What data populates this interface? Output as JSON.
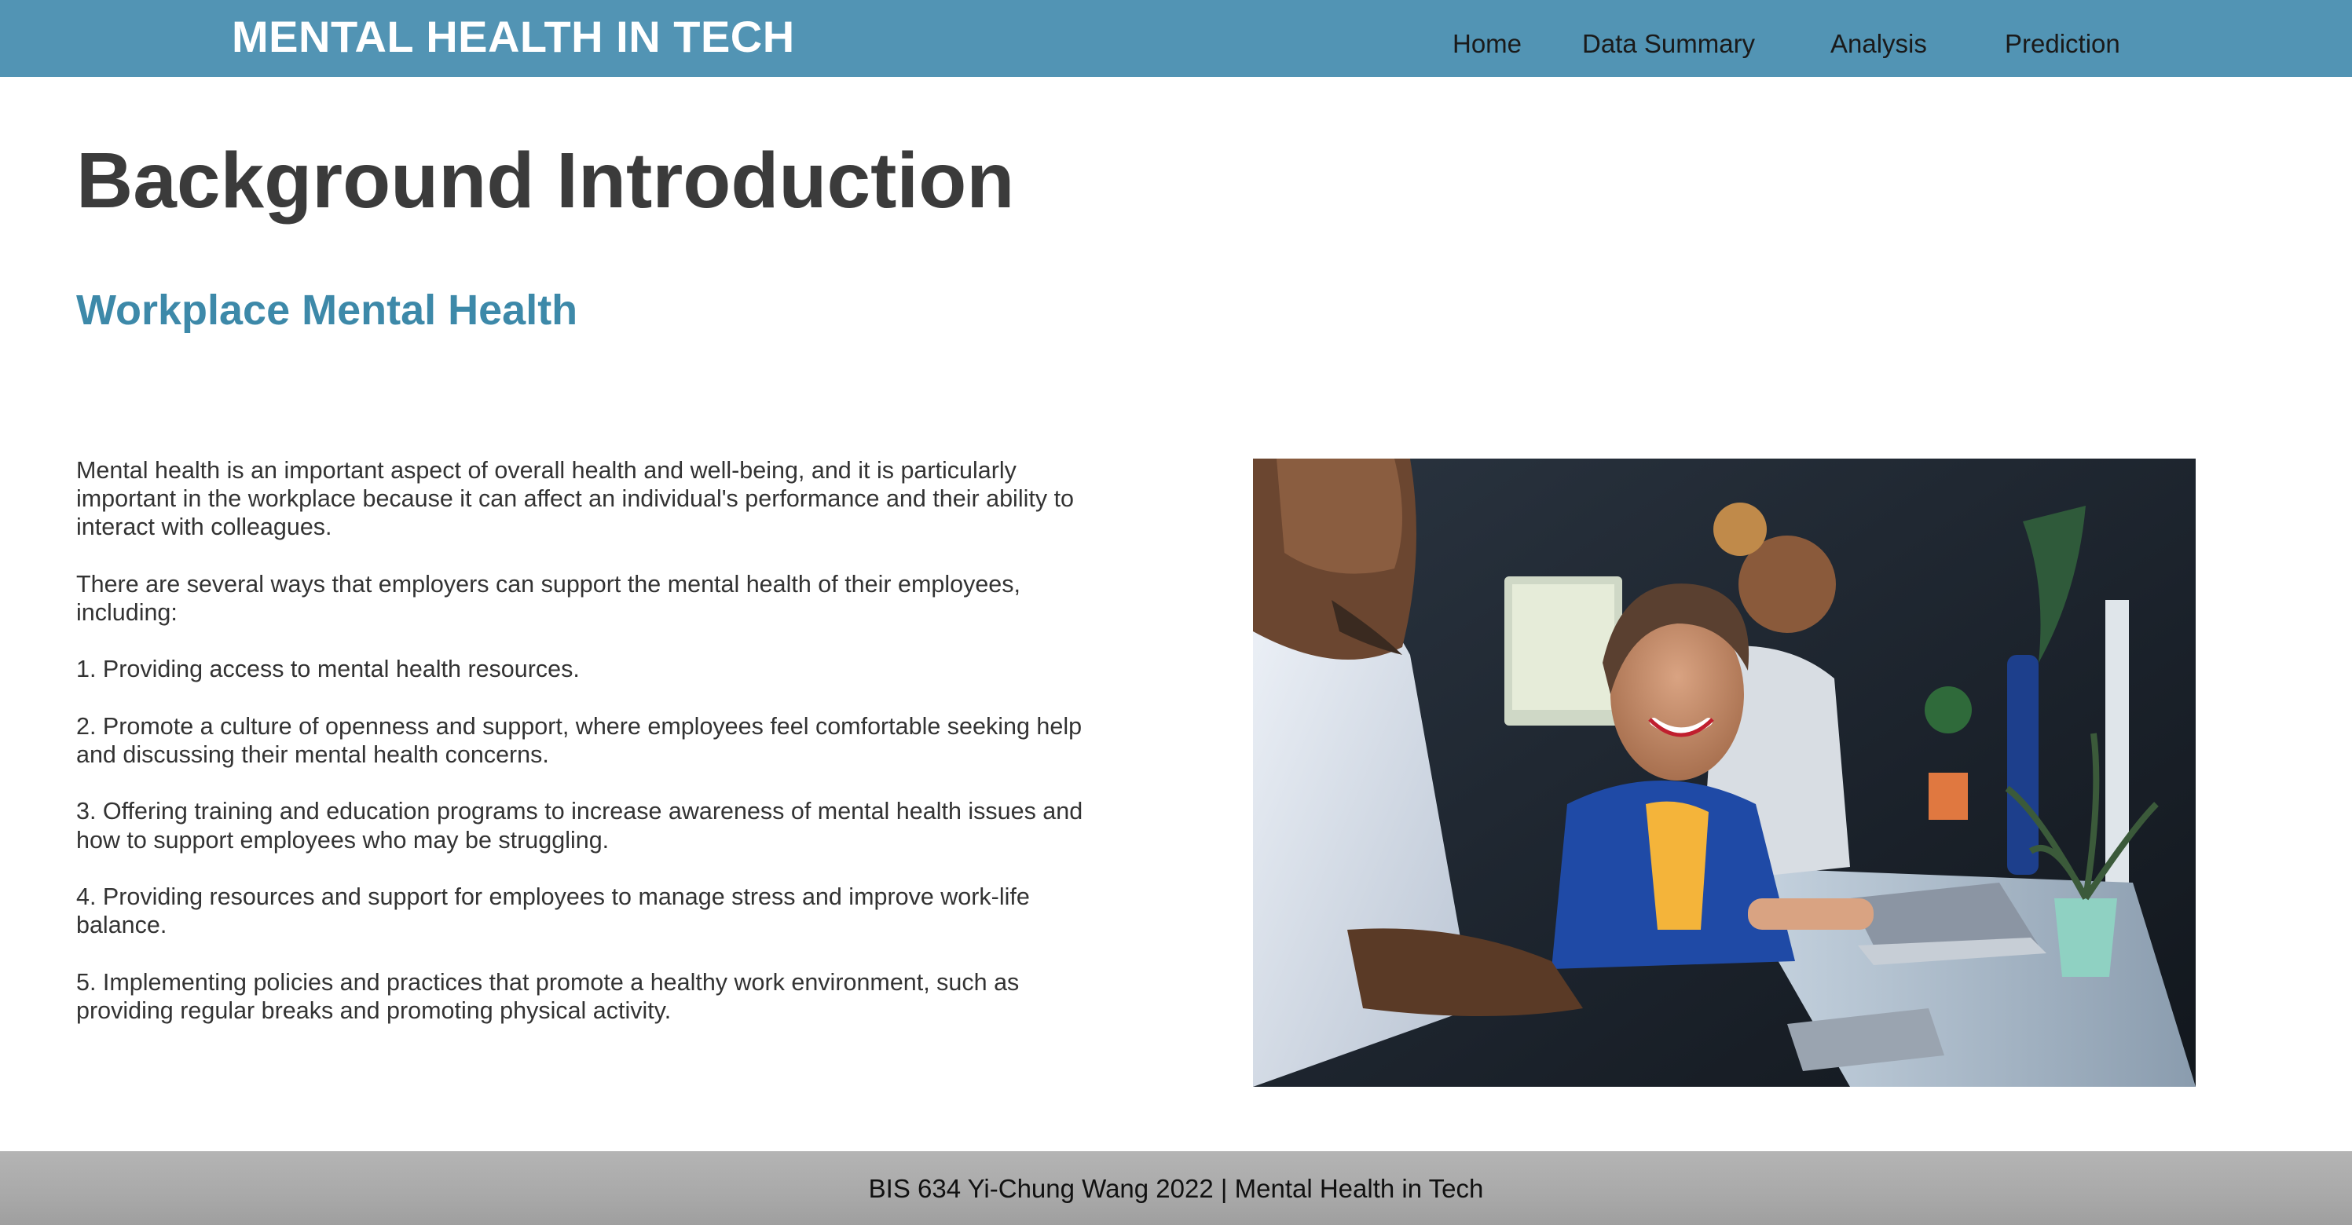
{
  "header": {
    "brand": "MENTAL HEALTH IN TECH",
    "nav": {
      "home": "Home",
      "data_summary": "Data Summary",
      "analysis": "Analysis",
      "prediction": "Prediction"
    }
  },
  "main": {
    "title": "Background Introduction",
    "subtitle": "Workplace Mental Health",
    "paragraphs": [
      "Mental health is an important aspect of overall health and well-being, and it is particularly important in the workplace because it can affect an individual's performance and their ability to interact with colleagues.",
      "There are several ways that employers can support the mental health of their employees, including:",
      "1. Providing access to mental health resources.",
      "2. Promote a culture of openness and support, where employees feel comfortable seeking help and discussing their mental health concerns.",
      "3. Offering training and education programs to increase awareness of mental health issues and how to support employees who may be struggling.",
      "4. Providing resources and support for employees to manage stress and improve work-life balance.",
      "5. Implementing policies and practices that promote a healthy work environment, such as providing regular breaks and promoting physical activity."
    ]
  },
  "footer": {
    "text": "BIS 634 Yi-Chung Wang 2022 | Mental Health in Tech"
  },
  "colors": {
    "navbar": "#5294b4",
    "subtitle": "#3d89a9",
    "title": "#3b3b3b",
    "footer": "#aaaaaa"
  }
}
